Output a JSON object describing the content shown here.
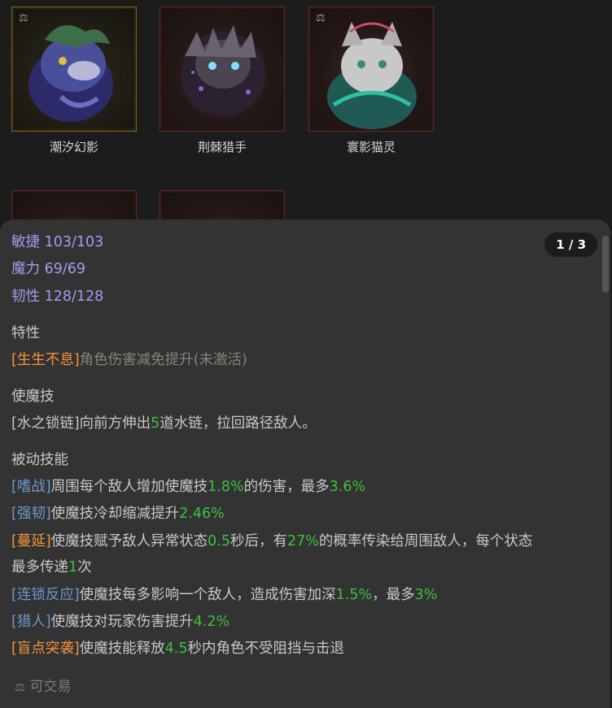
{
  "cards": [
    {
      "name": "潮汐幻影",
      "tradable": true
    },
    {
      "name": "荆棘猎手",
      "tradable": false
    },
    {
      "name": "寰影猫灵",
      "tradable": true
    }
  ],
  "pager": "1 / 3",
  "stats": [
    {
      "label": "敏捷 103/103"
    },
    {
      "label": "魔力 69/69"
    },
    {
      "label": "韧性 128/128"
    }
  ],
  "trait": {
    "heading": "特性",
    "tag": "[生生不息]",
    "text": "角色伤害减免提升(未激活)"
  },
  "active": {
    "heading": "使魔技",
    "p1": "[水之锁链]向前方伸出",
    "n1": "5",
    "p2": "道水链，拉回路径敌人。"
  },
  "passive": {
    "heading": "被动技能",
    "s1": {
      "tag": "[嗜战]",
      "a": "周围每个敌人增加使魔技",
      "n1": "1.8%",
      "b": "的伤害，最多",
      "n2": "3.6%"
    },
    "s2": {
      "tag": "[强韧]",
      "a": "使魔技冷却缩减提升",
      "n1": "2.46%"
    },
    "s3": {
      "tag": "[蔓延]",
      "a": "使魔技赋予敌人异常状态",
      "n1": "0.5",
      "b": "秒后，有",
      "n2": "27%",
      "c": "的概率传染给周围敌人，每个状态",
      "d": "最多传递",
      "n3": "1",
      "e": "次"
    },
    "s4": {
      "tag": "[连锁反应]",
      "a": "使魔技每多影响一个敌人，造成伤害加深",
      "n1": "1.5%",
      "b": "，最多",
      "n2": "3%"
    },
    "s5": {
      "tag": "[猎人]",
      "a": "使魔技对玩家伤害提升",
      "n1": "4.2%"
    },
    "s6": {
      "tag": "[盲点突袭]",
      "a": "使魔技能释放",
      "n1": "4.5",
      "b": "秒内角色不受阻挡与击退"
    }
  },
  "footer": {
    "icon": "scale-icon",
    "label": "可交易"
  }
}
